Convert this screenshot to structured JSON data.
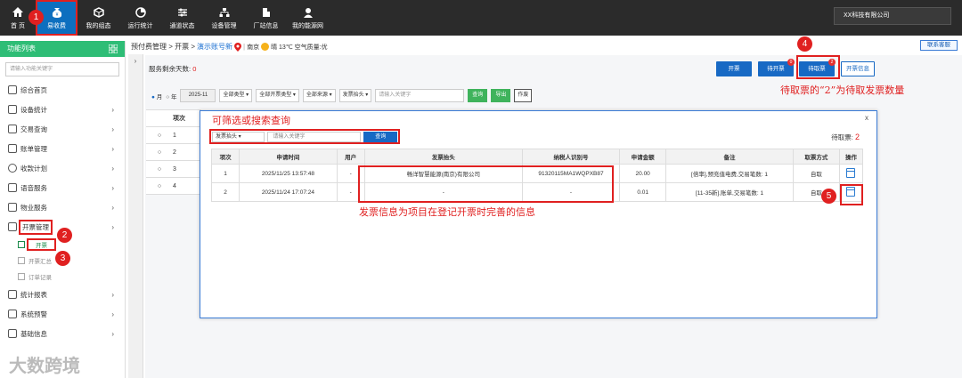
{
  "topnav": [
    {
      "label": "首 页",
      "icon": "home-icon"
    },
    {
      "label": "易收费",
      "icon": "money-bag-icon",
      "active": true
    },
    {
      "label": "我的组态",
      "icon": "cube-icon"
    },
    {
      "label": "运行统计",
      "icon": "pie-chart-icon"
    },
    {
      "label": "通道状态",
      "icon": "sliders-icon"
    },
    {
      "label": "设备管理",
      "icon": "network-icon"
    },
    {
      "label": "厂站信息",
      "icon": "building-icon"
    },
    {
      "label": "我的能源网",
      "icon": "user-icon"
    }
  ],
  "user_company": "XX科技有限公司",
  "sidebar": {
    "title": "功能列表",
    "search_placeholder": "请输入功能关键字",
    "items": [
      {
        "label": "综合首页",
        "arrow": ""
      },
      {
        "label": "设备统计",
        "arrow": "›"
      },
      {
        "label": "交易查询",
        "arrow": "›"
      },
      {
        "label": "账单管理",
        "arrow": "›"
      },
      {
        "label": "收款计划",
        "arrow": "›"
      },
      {
        "label": "语音服务",
        "arrow": "›"
      },
      {
        "label": "物业服务",
        "arrow": "›"
      },
      {
        "label": "开票管理",
        "arrow": "›"
      }
    ],
    "subitems": [
      "开票",
      "开票汇总",
      "订单记录"
    ],
    "items2": [
      {
        "label": "统计报表",
        "arrow": "›"
      },
      {
        "label": "系统预警",
        "arrow": "›"
      },
      {
        "label": "基础信息",
        "arrow": "›"
      }
    ]
  },
  "breadcrumb": {
    "part1": "预付费管理 > 开票 >",
    "link": "演示账号新",
    "city": "南京",
    "weather": "晴 13℃ 空气质量:优"
  },
  "contact_label": "联系客服",
  "days_left": {
    "label": "服务剩余天数:",
    "value": "0"
  },
  "actions": {
    "invoice": "开票",
    "pending_invoice": "待开票",
    "pending_invoice_count": "0",
    "pending_pickup": "待取票",
    "pending_pickup_count": "2",
    "invoice_info": "开票信息"
  },
  "filters": {
    "month": "月",
    "year": "年",
    "date": "2025-11",
    "type1": "全部类型",
    "type2": "全部开票类型",
    "type3": "全部来源",
    "type4": "发票抬头",
    "keyword_placeholder": "请输入关键字",
    "search": "查询",
    "export": "导出",
    "void": "作废"
  },
  "bg_table": {
    "header": "项次",
    "rows": [
      "1",
      "2",
      "3",
      "4"
    ]
  },
  "modal": {
    "close": "x",
    "filter_select": "发票抬头",
    "filter_placeholder": "请输入关键字",
    "filter_button": "查询",
    "pending_label": "待取票:",
    "pending_count": "2",
    "columns": [
      "项次",
      "申请时间",
      "用户",
      "发票抬头",
      "纳税人识别号",
      "申请金额",
      "备注",
      "取票方式",
      "操作"
    ],
    "rows": [
      [
        "1",
        "2025/11/25 13:57:48",
        "-",
        "畅洋智慧能源(南京)有限公司",
        "91320115MA1WQPXB87",
        "20.00",
        "[倍率],预充值电费,交易笔数: 1",
        "自取"
      ],
      [
        "2",
        "2025/11/24 17:07:24",
        "-",
        "-",
        "-",
        "0.01",
        "[11-35新],账单,交易笔数: 1",
        "自取"
      ]
    ]
  },
  "annotations": {
    "n1": "1",
    "n2": "2",
    "n3": "3",
    "n4": "4",
    "n5": "5",
    "filter_note": "可筛选或搜索查询",
    "pickup_note": "待取票的“2”为待取发票数量",
    "info_note": "发票信息为项目在登记开票时完善的信息"
  },
  "watermark": "大数跨境"
}
